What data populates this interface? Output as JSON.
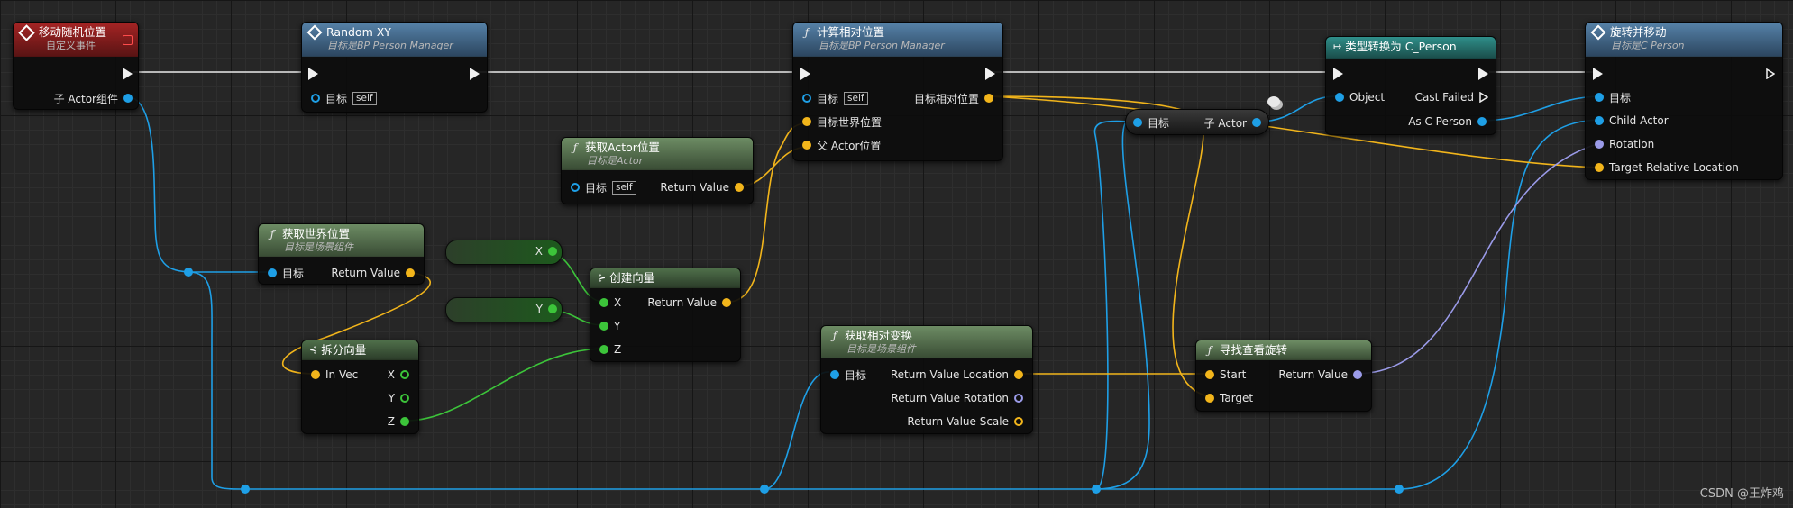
{
  "nodes": {
    "custom_event": {
      "title": "移动随机位置",
      "subtitle": "自定义事件",
      "out_component": "子 Actor组件"
    },
    "random_xy": {
      "title": "Random XY",
      "subtitle": "目标是BP Person Manager",
      "target": "目标",
      "self": "self"
    },
    "calc_rel": {
      "title": "计算相对位置",
      "subtitle": "目标是BP Person Manager",
      "target": "目标",
      "self": "self",
      "world_pos": "目标世界位置",
      "parent_pos": "父 Actor位置",
      "out": "目标相对位置"
    },
    "get_actor_loc": {
      "title": "获取Actor位置",
      "subtitle": "目标是Actor",
      "target": "目标",
      "self": "self",
      "out": "Return Value"
    },
    "get_world_loc": {
      "title": "获取世界位置",
      "subtitle": "目标是场景组件",
      "target": "目标",
      "out": "Return Value"
    },
    "literal_x": {
      "label": "X"
    },
    "literal_y": {
      "label": "Y"
    },
    "make_vector": {
      "title": "创建向量",
      "x": "X",
      "y": "Y",
      "z": "Z",
      "out": "Return Value"
    },
    "break_vector": {
      "title": "拆分向量",
      "in": "In Vec",
      "x": "X",
      "y": "Y",
      "z": "Z"
    },
    "get_child_actor": {
      "target": "目标",
      "out": "子 Actor"
    },
    "cast": {
      "title": "类型转换为 C_Person",
      "object": "Object",
      "failed": "Cast Failed",
      "as": "As C Person"
    },
    "get_rel_transform": {
      "title": "获取相对变换",
      "subtitle": "目标是场景组件",
      "target": "目标",
      "loc": "Return Value Location",
      "rot": "Return Value Rotation",
      "scale": "Return Value Scale"
    },
    "find_look_at": {
      "title": "寻找查看旋转",
      "start": "Start",
      "target": "Target",
      "out": "Return Value"
    },
    "rotate_move": {
      "title": "旋转并移动",
      "subtitle": "目标是C Person",
      "target": "目标",
      "child": "Child Actor",
      "rotation": "Rotation",
      "target_loc": "Target Relative Location"
    }
  },
  "watermark": "CSDN @王炸鸡",
  "colors": {
    "object_pin": "#1e9fe6",
    "vector_pin": "#f2b51b",
    "float_pin": "#3cc43a",
    "rotator_pin": "#9a9ae8",
    "exec_wire": "#f0f0f0"
  }
}
